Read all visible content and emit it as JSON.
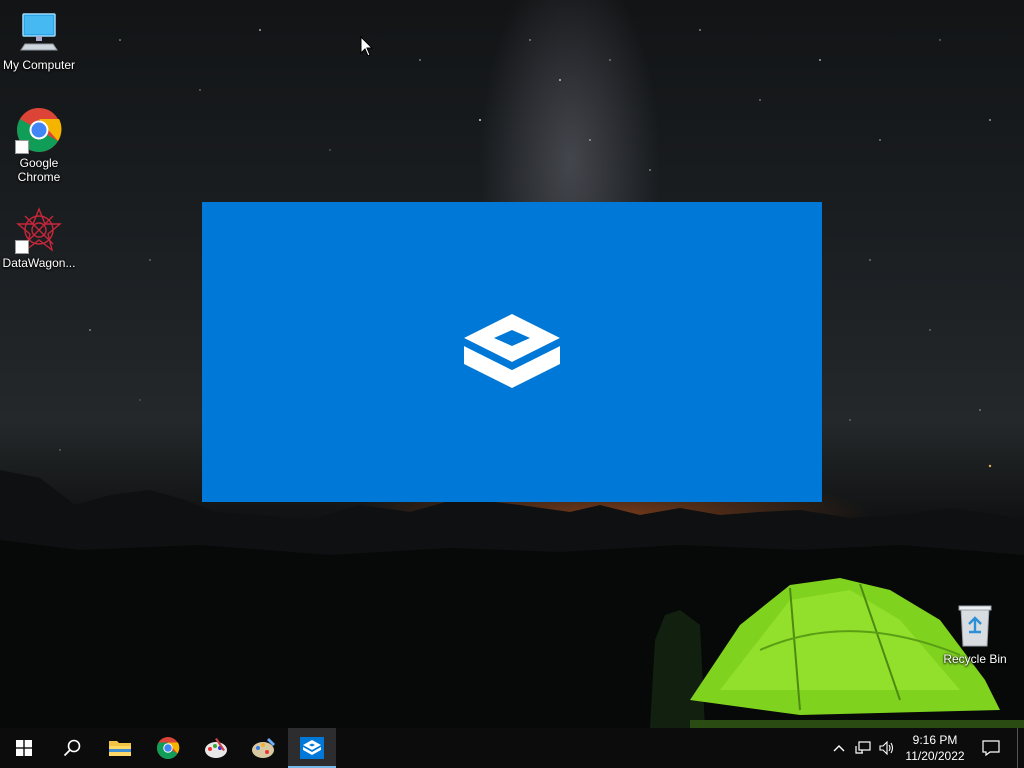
{
  "desktop": {
    "icons": [
      {
        "label": "My Computer"
      },
      {
        "label": "Google Chrome"
      },
      {
        "label": "DataWagon..."
      },
      {
        "label": "Recycle Bin"
      }
    ]
  },
  "splash": {
    "background": "#0078d7",
    "icon": "sandbox-box-icon"
  },
  "taskbar": {
    "background": "#0c0c0d",
    "buttons": [
      {
        "icon": "windows-start-icon"
      },
      {
        "icon": "search-icon"
      },
      {
        "icon": "file-explorer-icon"
      },
      {
        "icon": "chrome-icon"
      },
      {
        "icon": "paint-icon"
      },
      {
        "icon": "paint-palette-icon"
      },
      {
        "icon": "sandbox-app-icon",
        "active": true
      }
    ],
    "tray": {
      "icons": [
        "chevron-up-icon",
        "network-icon",
        "volume-icon",
        "notification-icon"
      ],
      "time": "9:16 PM",
      "date": "11/20/2022"
    }
  }
}
